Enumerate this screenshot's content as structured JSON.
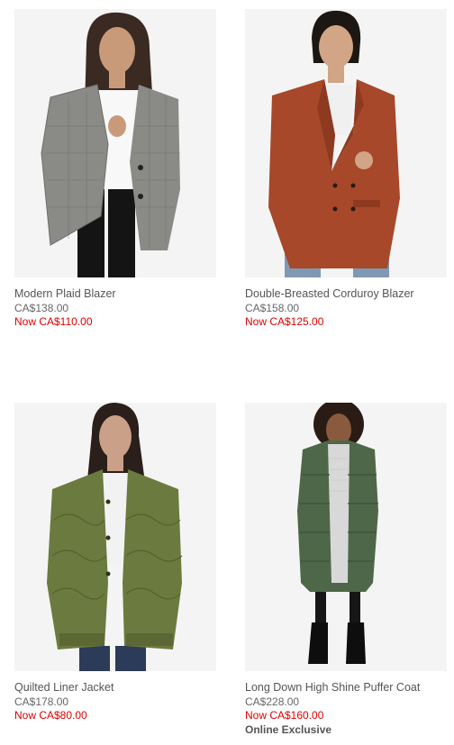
{
  "products": [
    {
      "name": "Modern Plaid Blazer",
      "original_price": "CA$138.00",
      "sale_price": "Now CA$110.00",
      "badge": "",
      "image": "model wearing grey plaid blazer",
      "coat_color": "#8a8a86"
    },
    {
      "name": "Double-Breasted Corduroy Blazer",
      "original_price": "CA$158.00",
      "sale_price": "Now CA$125.00",
      "badge": "",
      "image": "model wearing rust corduroy blazer",
      "coat_color": "#a7482a"
    },
    {
      "name": "Quilted Liner Jacket",
      "original_price": "CA$178.00",
      "sale_price": "Now CA$80.00",
      "badge": "",
      "image": "model wearing olive quilted jacket",
      "coat_color": "#6b7a3f"
    },
    {
      "name": "Long Down High Shine Puffer Coat",
      "original_price": "CA$228.00",
      "sale_price": "Now CA$160.00",
      "badge": "Online Exclusive",
      "image": "model wearing long green puffer coat",
      "coat_color": "#4e6749"
    }
  ],
  "colors": {
    "sale_red": "#dd0000",
    "text_grey": "#555555",
    "photo_bg": "#f3f3f3"
  }
}
